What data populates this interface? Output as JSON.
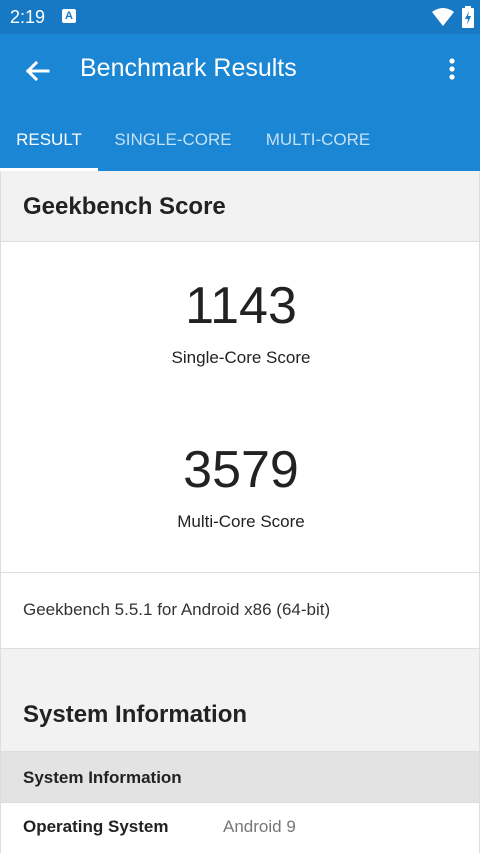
{
  "status": {
    "time": "2:19",
    "notif_glyph": "A",
    "icons": [
      "wifi-icon",
      "battery-charging-icon"
    ]
  },
  "appbar": {
    "title": "Benchmark Results",
    "back_icon": "arrow-back-icon",
    "menu_icon": "more-vert-icon"
  },
  "tabs": [
    {
      "label": "RESULT",
      "active": true
    },
    {
      "label": "SINGLE-CORE",
      "active": false
    },
    {
      "label": "MULTI-CORE",
      "active": false
    }
  ],
  "geekbench": {
    "header": "Geekbench Score",
    "single": {
      "value": "1143",
      "label": "Single-Core Score"
    },
    "multi": {
      "value": "3579",
      "label": "Multi-Core Score"
    },
    "version": "Geekbench 5.5.1 for Android x86 (64-bit)"
  },
  "system": {
    "header": "System Information",
    "subheader": "System Information",
    "rows": [
      {
        "key": "Operating System",
        "value": "Android 9"
      }
    ]
  },
  "colors": {
    "accent": "#1a86d4",
    "statusbar": "#1779c4"
  }
}
